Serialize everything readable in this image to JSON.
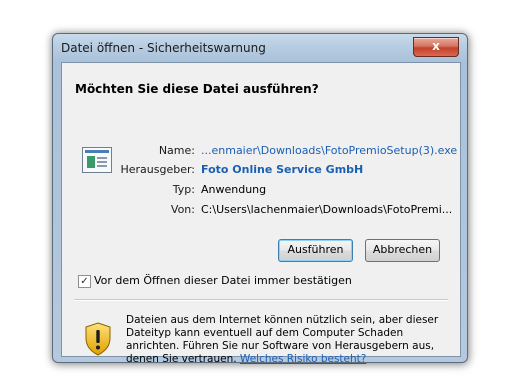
{
  "window": {
    "title": "Datei öffnen - Sicherheitswarnung",
    "close_glyph": "x"
  },
  "dialog": {
    "heading": "Möchten Sie diese Datei ausführen?",
    "icon": "application-file-icon",
    "fields": {
      "name_label": "Name:",
      "name_value": "...enmaier\\Downloads\\FotoPremioSetup(3).exe",
      "publisher_label": "Herausgeber:",
      "publisher_value": "Foto Online Service GmbH",
      "type_label": "Typ:",
      "type_value": "Anwendung",
      "from_label": "Von:",
      "from_value": "C:\\Users\\lachenmaier\\Downloads\\FotoPremi..."
    },
    "buttons": {
      "run": "Ausführen",
      "cancel": "Abbrechen"
    },
    "checkbox": {
      "label": "Vor dem Öffnen dieser Datei immer bestätigen",
      "checked": true,
      "glyph": "✓"
    },
    "warning": {
      "icon": "shield-warning-icon",
      "text": "Dateien aus dem Internet können nützlich sein, aber dieser Dateityp kann eventuell auf dem Computer Schaden anrichten. Führen Sie nur Software von Herausgebern aus, denen Sie vertrauen.",
      "link": "Welches Risiko besteht?"
    }
  },
  "colors": {
    "link": "#1a5fb4",
    "close_button": "#c2412b"
  }
}
